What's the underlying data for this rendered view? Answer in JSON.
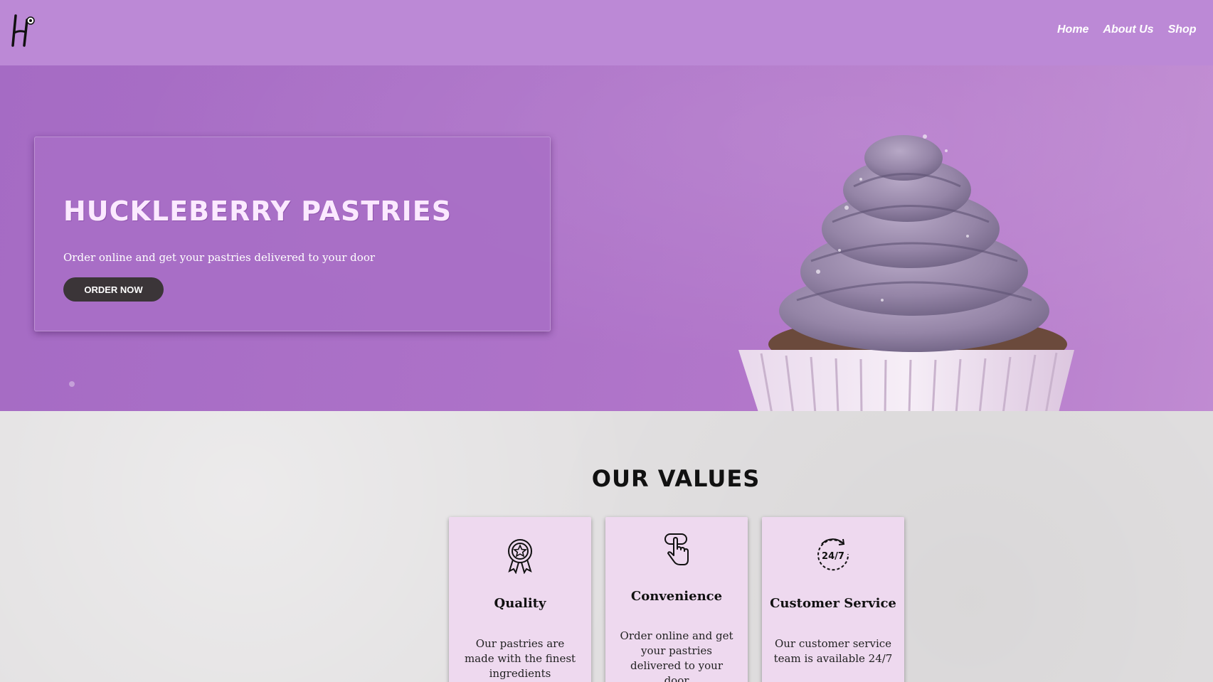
{
  "header": {
    "logo_icon": "brand-logo-icon",
    "nav": [
      "Home",
      "About Us",
      "Shop"
    ]
  },
  "hero": {
    "title": "HUCKLEBERRY PASTRIES",
    "subtitle": "Order online and get your pastries delivered to your door",
    "cta": "ORDER NOW",
    "image": "cupcake-image"
  },
  "values": {
    "title": "OUR VALUES",
    "cards": [
      {
        "icon": "award-ribbon-icon",
        "name": "Quality",
        "description": "Our pastries are made with the finest ingredients"
      },
      {
        "icon": "touch-tap-icon",
        "name": "Convenience",
        "description": "Order online and get your pastries delivered to your door"
      },
      {
        "icon": "support-24-7-icon",
        "name": "Customer Service",
        "description": "Our customer service team is available 24/7"
      }
    ]
  },
  "colors": {
    "header_bg": "#bc89d6",
    "hero_bg": "#ad72c8",
    "card_bg": "#eed9ef",
    "button_bg": "#3b3538"
  }
}
